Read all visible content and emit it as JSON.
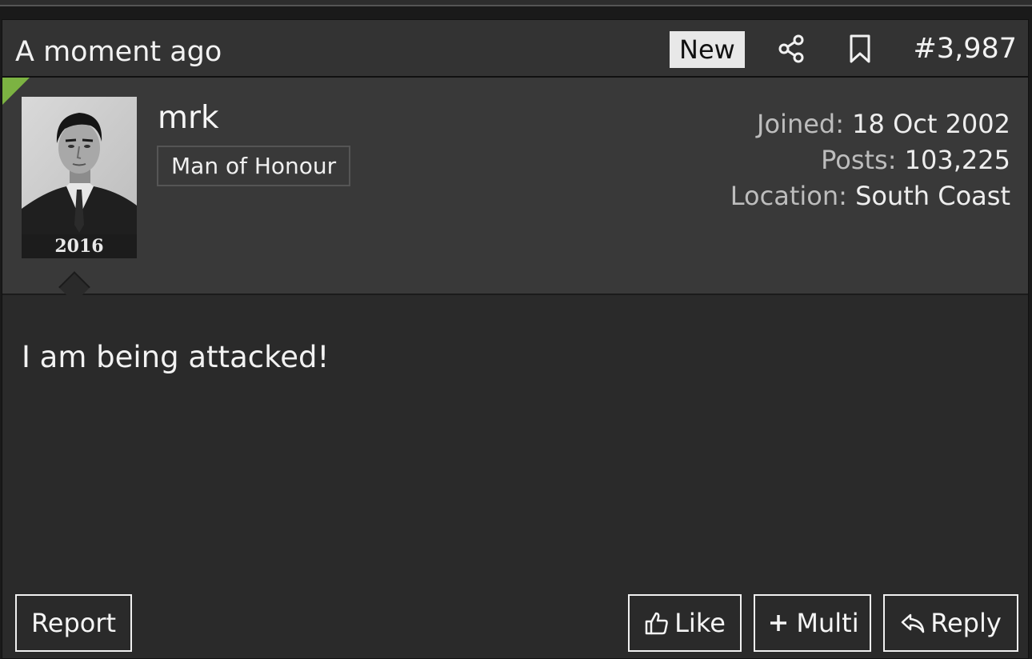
{
  "post": {
    "time": "A moment ago",
    "new_badge": "New",
    "post_number": "#3,987",
    "body": "I am being attacked!"
  },
  "user": {
    "name": "mrk",
    "title": "Man of Honour",
    "avatar_caption": "2016",
    "stats": {
      "joined_label": "Joined:",
      "joined_value": "18 Oct 2002",
      "posts_label": "Posts:",
      "posts_value": "103,225",
      "location_label": "Location:",
      "location_value": "South Coast"
    }
  },
  "actions": {
    "report": "Report",
    "like": "Like",
    "multi": "Multi",
    "reply": "Reply"
  },
  "icons": {
    "share": "share-icon",
    "bookmark": "bookmark-icon",
    "like": "thumbs-up-icon",
    "multi": "plus-icon",
    "reply": "reply-arrow-icon"
  },
  "colors": {
    "new_indicator": "#7cb342",
    "header_bg": "#333333",
    "userbar_bg": "#393939",
    "body_bg": "#2a2a2a"
  }
}
